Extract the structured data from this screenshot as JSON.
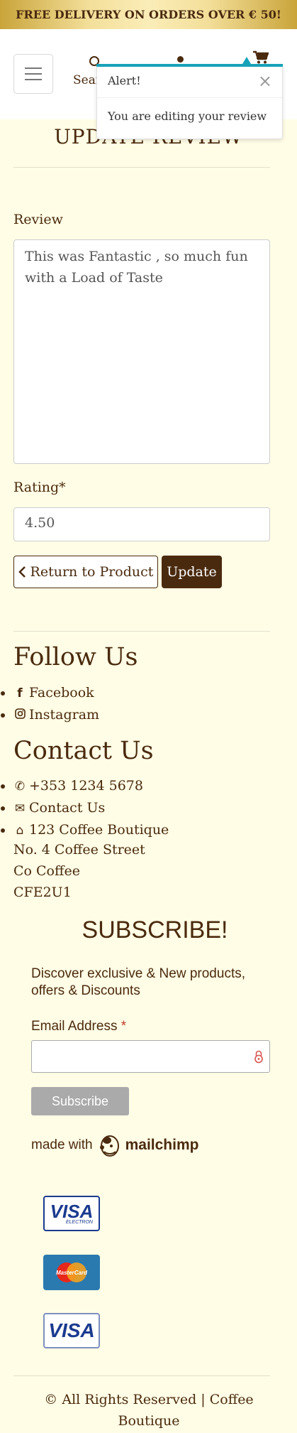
{
  "banner": {
    "text": "FREE DELIVERY ON ORDERS OVER € 50!"
  },
  "header": {
    "search_label": "Search",
    "icons": [
      "menu-icon",
      "search-icon",
      "account-icon",
      "cart-icon"
    ]
  },
  "toast": {
    "title": "Alert!",
    "close_symbol": "×",
    "message": "You are editing your review",
    "accent": "#17a2b8"
  },
  "page": {
    "title": "UPDATE REVIEW"
  },
  "form": {
    "review_label": "Review",
    "review_value": "This was Fantastic , so much fun with a Load of Taste",
    "rating_label": "Rating*",
    "rating_value": "4.50",
    "return_label": "Return to Product",
    "update_label": "Update"
  },
  "follow": {
    "heading": "Follow Us",
    "items": [
      {
        "icon": "facebook-icon",
        "label": "Facebook"
      },
      {
        "icon": "instagram-icon",
        "label": "Instagram"
      }
    ]
  },
  "contact": {
    "heading": "Contact Us",
    "items": [
      {
        "icon": "phone-icon",
        "label": "+353 1234 5678"
      },
      {
        "icon": "envelope-icon",
        "label": "Contact Us"
      },
      {
        "icon": "home-icon",
        "label": "123 Coffee Boutique"
      }
    ],
    "address_lines": [
      "No. 4 Coffee Street",
      "Co Coffee",
      "CFE2U1"
    ]
  },
  "subscribe": {
    "title": "SUBSCRIBE!",
    "text": "Discover exclusive & New products, offers & Discounts",
    "email_label": "Email Address",
    "required_mark": "*",
    "button_label": "Subscribe",
    "made_with": "made with",
    "brand": "mailchimp"
  },
  "payments": {
    "visa_electron": {
      "brand": "VISA",
      "sub": "ELECTRON"
    },
    "mastercard": {
      "brand": "MasterCard"
    },
    "visa": {
      "brand": "VISA"
    }
  },
  "footer": {
    "symbol": "©",
    "text": "All Rights Reserved | Coffee Boutique"
  },
  "colors": {
    "brand_brown": "#4a2a0e",
    "page_bg": "#fffde6",
    "info": "#17a2b8"
  }
}
